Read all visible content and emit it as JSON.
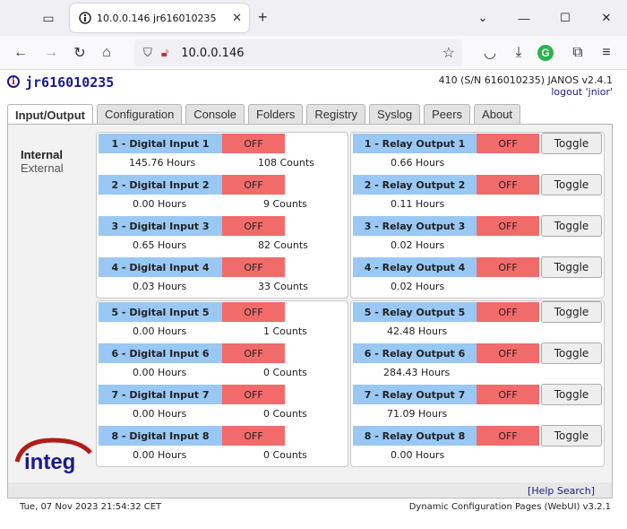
{
  "browser": {
    "tab_title": "10.0.0.146 jr616010235",
    "url": "10.0.0.146"
  },
  "header": {
    "device_name": "jr616010235",
    "device_info": "410 (S/N 616010235) JANOS v2.4.1",
    "logout": "logout 'jnior'"
  },
  "tabs": [
    "Input/Output",
    "Configuration",
    "Console",
    "Folders",
    "Registry",
    "Syslog",
    "Peers",
    "About"
  ],
  "active_tab": "Input/Output",
  "side_nav": {
    "internal": "Internal",
    "external": "External"
  },
  "inputs": [
    {
      "label": "1 - Digital Input 1",
      "state": "OFF",
      "hours": "145.76 Hours",
      "counts": "108 Counts"
    },
    {
      "label": "2 - Digital Input 2",
      "state": "OFF",
      "hours": "0.00 Hours",
      "counts": "9 Counts"
    },
    {
      "label": "3 - Digital Input 3",
      "state": "OFF",
      "hours": "0.65 Hours",
      "counts": "82 Counts"
    },
    {
      "label": "4 - Digital Input 4",
      "state": "OFF",
      "hours": "0.03 Hours",
      "counts": "33 Counts"
    },
    {
      "label": "5 - Digital Input 5",
      "state": "OFF",
      "hours": "0.00 Hours",
      "counts": "1 Counts"
    },
    {
      "label": "6 - Digital Input 6",
      "state": "OFF",
      "hours": "0.00 Hours",
      "counts": "0 Counts"
    },
    {
      "label": "7 - Digital Input 7",
      "state": "OFF",
      "hours": "0.00 Hours",
      "counts": "0 Counts"
    },
    {
      "label": "8 - Digital Input 8",
      "state": "OFF",
      "hours": "0.00 Hours",
      "counts": "0 Counts"
    }
  ],
  "outputs": [
    {
      "label": "1 - Relay Output 1",
      "state": "OFF",
      "hours": "0.66 Hours",
      "toggle": "Toggle"
    },
    {
      "label": "2 - Relay Output 2",
      "state": "OFF",
      "hours": "0.11 Hours",
      "toggle": "Toggle"
    },
    {
      "label": "3 - Relay Output 3",
      "state": "OFF",
      "hours": "0.02 Hours",
      "toggle": "Toggle"
    },
    {
      "label": "4 - Relay Output 4",
      "state": "OFF",
      "hours": "0.02 Hours",
      "toggle": "Toggle"
    },
    {
      "label": "5 - Relay Output 5",
      "state": "OFF",
      "hours": "42.48 Hours",
      "toggle": "Toggle"
    },
    {
      "label": "6 - Relay Output 6",
      "state": "OFF",
      "hours": "284.43 Hours",
      "toggle": "Toggle"
    },
    {
      "label": "7 - Relay Output 7",
      "state": "OFF",
      "hours": "71.09 Hours",
      "toggle": "Toggle"
    },
    {
      "label": "8 - Relay Output 8",
      "state": "OFF",
      "hours": "0.00 Hours",
      "toggle": "Toggle"
    }
  ],
  "logo_text": "integ",
  "footer": {
    "help": "[Help Search]",
    "datetime": "Tue, 07 Nov 2023 21:54:32 CET",
    "version": "Dynamic Configuration Pages (WebUI) v3.2.1"
  },
  "colors": {
    "label_blue": "#99c8f4",
    "state_red": "#f26b6b",
    "brand_navy": "#1a1a8c",
    "logo_red": "#b31b1b"
  }
}
